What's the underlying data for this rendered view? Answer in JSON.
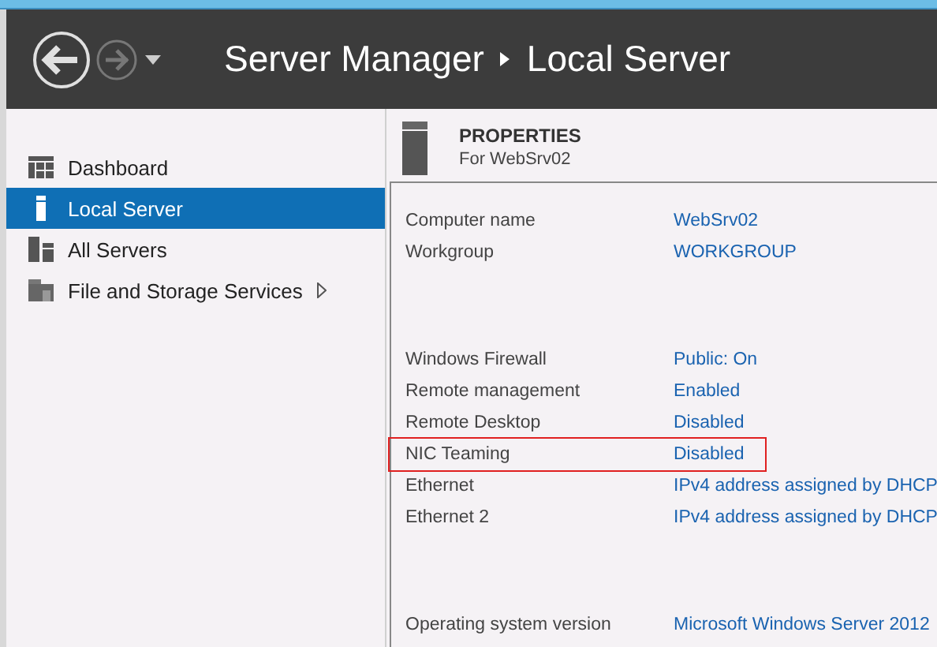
{
  "header": {
    "title": "Server Manager",
    "page": "Local Server"
  },
  "sidebar": {
    "items": [
      {
        "label": "Dashboard",
        "kind": "dashboard",
        "selected": false,
        "expandable": false
      },
      {
        "label": "Local Server",
        "kind": "server",
        "selected": true,
        "expandable": false
      },
      {
        "label": "All Servers",
        "kind": "servers",
        "selected": false,
        "expandable": false
      },
      {
        "label": "File and Storage Services",
        "kind": "storage",
        "selected": false,
        "expandable": true
      }
    ]
  },
  "properties": {
    "title": "PROPERTIES",
    "subtitle": "For WebSrv02",
    "groups": [
      [
        {
          "label": "Computer name",
          "value": "WebSrv02",
          "highlighted": false
        },
        {
          "label": "Workgroup",
          "value": "WORKGROUP",
          "highlighted": false
        }
      ],
      [
        {
          "label": "Windows Firewall",
          "value": "Public: On",
          "highlighted": false
        },
        {
          "label": "Remote management",
          "value": "Enabled",
          "highlighted": false
        },
        {
          "label": "Remote Desktop",
          "value": "Disabled",
          "highlighted": false
        },
        {
          "label": "NIC Teaming",
          "value": "Disabled",
          "highlighted": true
        },
        {
          "label": "Ethernet",
          "value": "IPv4 address assigned by DHCP",
          "highlighted": false
        },
        {
          "label": "Ethernet 2",
          "value": "IPv4 address assigned by DHCP",
          "highlighted": false
        }
      ],
      [
        {
          "label": "Operating system version",
          "value": "Microsoft Windows Server 2012",
          "highlighted": false
        }
      ]
    ]
  }
}
